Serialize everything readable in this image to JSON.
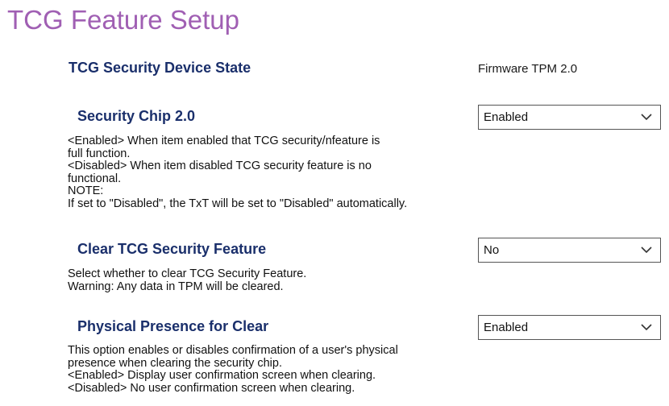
{
  "page_title": "TCG Feature Setup",
  "device_state": {
    "label": "TCG Security Device State",
    "value": "Firmware TPM 2.0"
  },
  "security_chip": {
    "label": "Security Chip 2.0",
    "selected": "Enabled",
    "description": [
      "<Enabled> When item enabled that TCG security/nfeature is",
      "full function.",
      "<Disabled> When item disabled TCG security feature is no",
      "functional.",
      "NOTE:",
      "If set to \"Disabled\", the TxT will be set to \"Disabled\" automatically."
    ]
  },
  "clear_tcg": {
    "label": "Clear TCG Security Feature",
    "selected": "No",
    "description": [
      "Select whether to clear TCG Security Feature.",
      "Warning: Any data in TPM will be cleared."
    ]
  },
  "physical_presence": {
    "label": "Physical Presence for Clear",
    "selected": "Enabled",
    "description": [
      "This option enables or disables confirmation of a user's physical",
      "presence when clearing the security chip.",
      "<Enabled> Display user confirmation screen when clearing.",
      "<Disabled> No user confirmation screen when clearing."
    ]
  },
  "icons": {
    "dropdown": "chevron-down-icon"
  },
  "colors": {
    "title": "#a05fb3",
    "label": "#1a2f6b",
    "select_border": "#555555"
  }
}
